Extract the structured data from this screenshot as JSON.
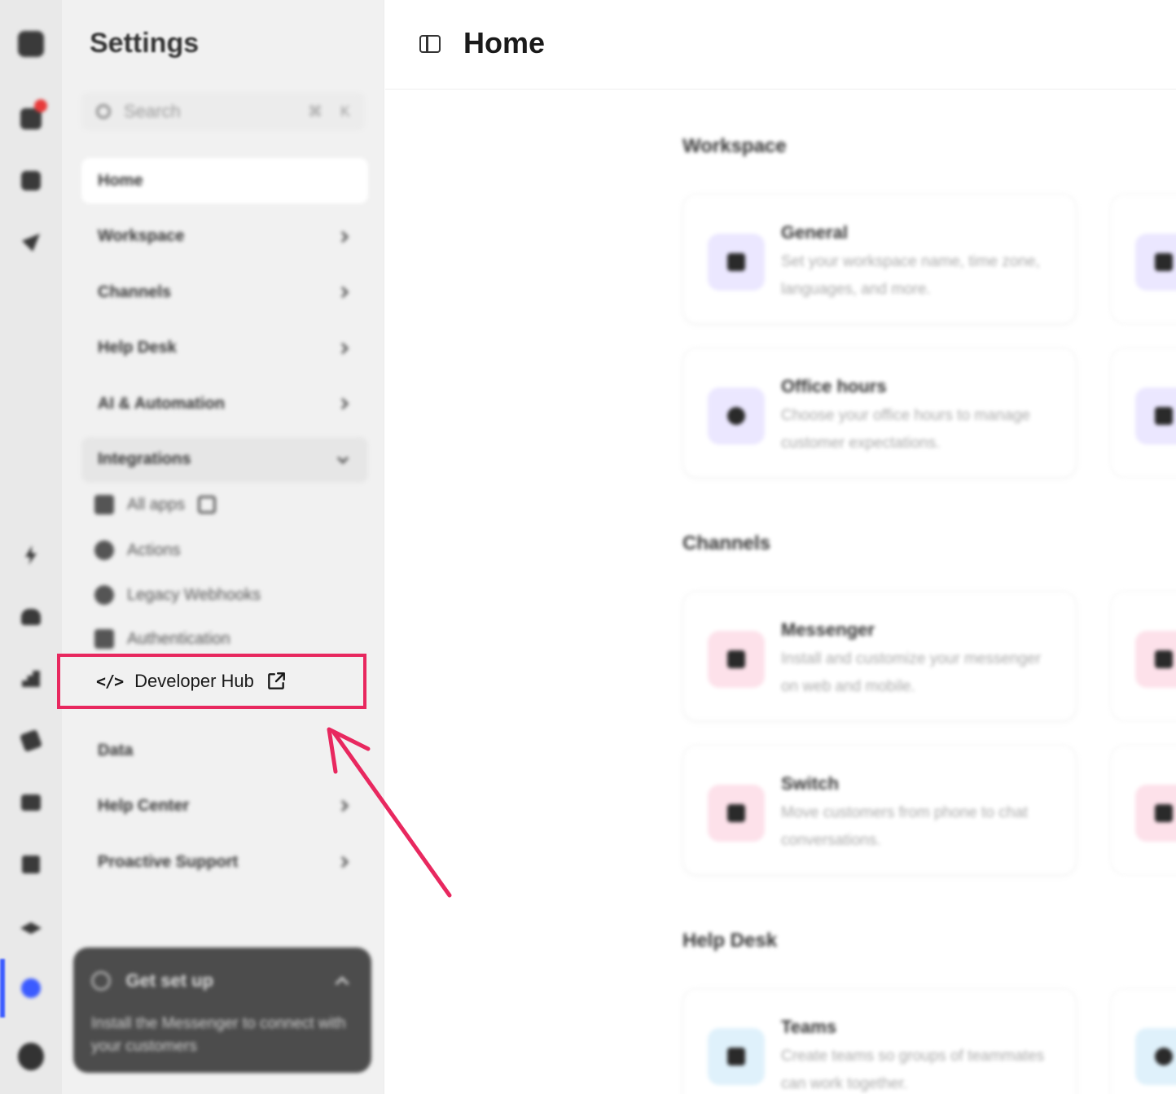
{
  "sidebar": {
    "title": "Settings",
    "search": {
      "placeholder": "Search",
      "shortcut_1": "⌘",
      "shortcut_2": "K"
    },
    "items": [
      {
        "label": "Home"
      },
      {
        "label": "Workspace"
      },
      {
        "label": "Channels"
      },
      {
        "label": "Help Desk"
      },
      {
        "label": "AI & Automation"
      },
      {
        "label": "Integrations"
      }
    ],
    "integrations_sub": [
      {
        "label": "All apps"
      },
      {
        "label": "Actions"
      },
      {
        "label": "Legacy Webhooks"
      },
      {
        "label": "Authentication"
      }
    ],
    "developer_hub": {
      "label": "Developer Hub",
      "icon": "code-icon"
    },
    "items_after": [
      {
        "label": "Data"
      },
      {
        "label": "Help Center"
      },
      {
        "label": "Proactive Support"
      }
    ],
    "get_set_up": {
      "title": "Get set up",
      "description": "Install the Messenger to connect with your customers"
    }
  },
  "main": {
    "title": "Home",
    "sections": [
      {
        "title": "Workspace",
        "cards": [
          {
            "title": "General",
            "description": "Set your workspace name, time zone, languages, and more."
          },
          {
            "title": "Office hours",
            "description": "Choose your office hours to manage customer expectations."
          }
        ]
      },
      {
        "title": "Channels",
        "cards": [
          {
            "title": "Messenger",
            "description": "Install and customize your messenger on web and mobile."
          },
          {
            "title": "Switch",
            "description": "Move customers from phone to chat conversations."
          }
        ]
      },
      {
        "title": "Help Desk",
        "cards": [
          {
            "title": "Teams",
            "description": "Create teams so groups of teammates can work together."
          }
        ]
      }
    ]
  },
  "colors": {
    "highlight": "#e8285f",
    "active_rail": "#3b5bff",
    "icon_purple_bg": "#ebe7ff",
    "icon_pink_bg": "#fde1ea",
    "icon_blue_bg": "#dff1fb"
  }
}
